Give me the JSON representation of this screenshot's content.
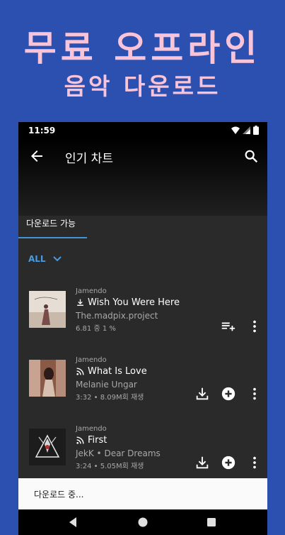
{
  "promo": {
    "title": "무료 오프라인",
    "subtitle": "음악 다운로드"
  },
  "status_bar": {
    "time": "11:59",
    "icons": [
      "wifi-icon",
      "signal-icon",
      "battery-icon"
    ]
  },
  "header": {
    "title": "인기 차트",
    "back_icon": "arrow-back-icon",
    "search_icon": "search-icon"
  },
  "tabs": [
    {
      "label": "다운로드 가능",
      "selected": true
    }
  ],
  "filter": {
    "label": "ALL",
    "icon": "chevron-down-icon"
  },
  "tracks": [
    {
      "source": "Jamendo",
      "title": "Wish You Were Here",
      "title_icon": "download-small-icon",
      "artist": "The.madpix.project",
      "meta": "6.81 중 1 %",
      "actions": [
        "playlist-add-icon",
        "more-vert-icon"
      ]
    },
    {
      "source": "Jamendo",
      "title": "What Is Love",
      "title_icon": "stream-icon",
      "artist": "Melanie Ungar",
      "meta": "3:32 • 8.09M회 재생",
      "actions": [
        "download-icon",
        "add-circle-icon",
        "more-vert-icon"
      ]
    },
    {
      "source": "Jamendo",
      "title": "First",
      "title_icon": "stream-icon",
      "artist": "JekK • Dear Dreams",
      "meta": "3:24 • 5.05M회 재생",
      "actions": [
        "download-icon",
        "add-circle-icon",
        "more-vert-icon"
      ]
    }
  ],
  "snackbar": {
    "text": "다운로드 중..."
  },
  "nav_bar": {
    "icons": [
      "nav-back-icon",
      "nav-home-icon",
      "nav-recents-icon"
    ]
  },
  "colors": {
    "background": "#2c50b0",
    "promo_text": "#f9c3d8",
    "accent": "#3f93d6",
    "surface": "#2a2a2a"
  }
}
